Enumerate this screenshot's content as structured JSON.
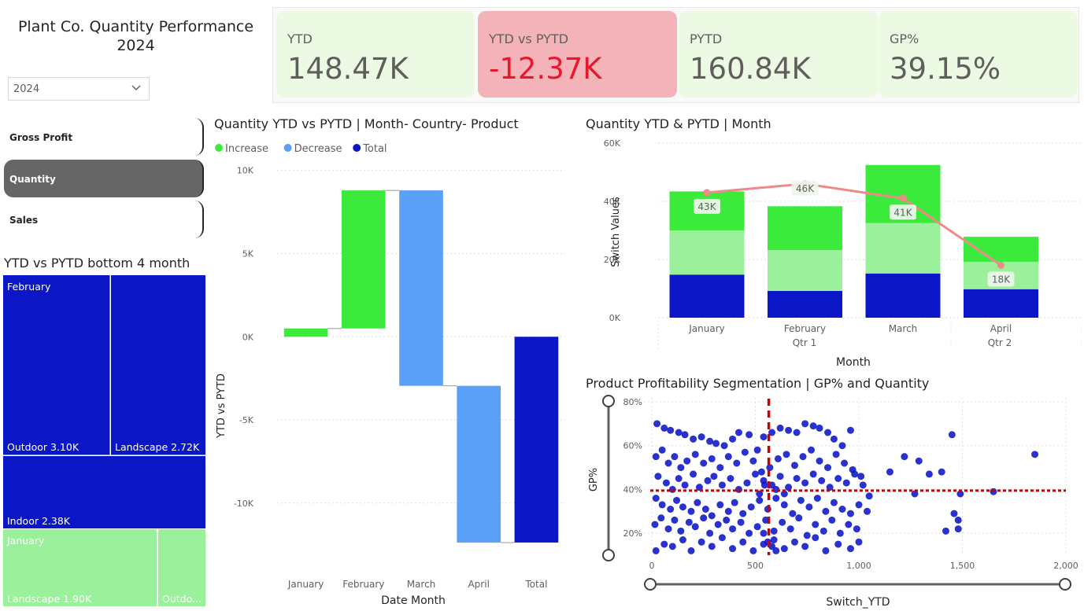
{
  "header": {
    "title": "Plant Co. Quantity Performance 2024",
    "year_value": "2024"
  },
  "kpis": [
    {
      "label": "YTD",
      "value": "148.47K"
    },
    {
      "label": "YTD vs PYTD",
      "value": "-12.37K"
    },
    {
      "label": "PYTD",
      "value": "160.84K"
    },
    {
      "label": "GP%",
      "value": "39.15%"
    }
  ],
  "nav": {
    "gross_profit": "Gross Profit",
    "quantity": "Quantity",
    "sales": "Sales"
  },
  "treemap": {
    "title": "YTD vs PYTD bottom 4 month",
    "february": "February",
    "january": "January",
    "cells": [
      "Outdoor 3.10K",
      "Landscape 2.72K",
      "Indoor 2.38K",
      "Landscape 1.90K",
      "Outdo..."
    ],
    "colors": {
      "feb": "#0b16c7",
      "jan": "#9bf09b"
    }
  },
  "chart_data": [
    {
      "type": "bar",
      "title": "Quantity YTD vs PYTD | Month- Country- Product",
      "xlabel": "Date Month",
      "ylabel": "YTD vs PYTD",
      "legend": [
        "Increase",
        "Decrease",
        "Total"
      ],
      "legend_colors": [
        "#3cea3c",
        "#5aa0f8",
        "#0b16c7"
      ],
      "categories": [
        "January",
        "February",
        "March",
        "April",
        "Total"
      ],
      "waterfall": [
        {
          "start": 0,
          "end": 500,
          "kind": "Increase"
        },
        {
          "start": 500,
          "end": 8800,
          "kind": "Increase"
        },
        {
          "start": 8800,
          "end": -2950,
          "kind": "Decrease"
        },
        {
          "start": -2950,
          "end": -12370,
          "kind": "Decrease"
        },
        {
          "start": 0,
          "end": -12370,
          "kind": "Total"
        }
      ],
      "yticks": [
        10000,
        5000,
        0,
        -5000,
        -10000
      ],
      "ytick_labels": [
        "10K",
        "5K",
        "0K",
        "-5K",
        "-10K"
      ],
      "ylim": [
        -14500,
        11500
      ]
    },
    {
      "type": "bar",
      "title": "Quantity YTD & PYTD | Month",
      "xlabel": "Month",
      "ylabel": "Switch Values",
      "categories": [
        "January",
        "February",
        "March",
        "April"
      ],
      "quarter_labels": [
        "Qtr 1",
        "Qtr 2"
      ],
      "series": [
        {
          "values": [
            14800,
            9200,
            15200,
            9800
          ],
          "color": "#0b16c7"
        },
        {
          "values": [
            15200,
            14000,
            17300,
            9400
          ],
          "color": "#9bf09b"
        },
        {
          "values": [
            13400,
            15100,
            20000,
            8600
          ],
          "color": "#3cea3c"
        }
      ],
      "line": {
        "values": [
          43000,
          46000,
          41000,
          18000
        ],
        "labels": [
          "43K",
          "46K",
          "41K",
          "18K"
        ],
        "color": "#f08a8a"
      },
      "yticks": [
        0,
        20000,
        40000,
        60000
      ],
      "ytick_labels": [
        "0K",
        "20K",
        "40K",
        "60K"
      ],
      "ylim": [
        0,
        60000
      ]
    },
    {
      "type": "scatter",
      "title": "Product Profitability Segmentation | GP% and Quantity",
      "xlabel": "Switch_YTD",
      "ylabel": "GP%",
      "xticks": [
        0,
        500,
        1000,
        1500,
        2000
      ],
      "xtick_labels": [
        "0",
        "500",
        "1,000",
        "1,500",
        "2,000"
      ],
      "yticks": [
        20,
        40,
        60,
        80
      ],
      "ytick_labels": [
        "20%",
        "40%",
        "60%",
        "80%"
      ],
      "xlim": [
        0,
        2000
      ],
      "ylim": [
        10,
        80
      ],
      "ref_x": 565,
      "ref_y": 39.5,
      "point_color": "#0b16c7",
      "points": [
        [
          25,
          70
        ],
        [
          60,
          68
        ],
        [
          90,
          67
        ],
        [
          130,
          66
        ],
        [
          160,
          65
        ],
        [
          200,
          63
        ],
        [
          240,
          64
        ],
        [
          280,
          62
        ],
        [
          310,
          61
        ],
        [
          350,
          60
        ],
        [
          390,
          63
        ],
        [
          420,
          66
        ],
        [
          470,
          65
        ],
        [
          510,
          58
        ],
        [
          540,
          64
        ],
        [
          580,
          66
        ],
        [
          620,
          68
        ],
        [
          660,
          67
        ],
        [
          700,
          66
        ],
        [
          740,
          70
        ],
        [
          780,
          69
        ],
        [
          810,
          68
        ],
        [
          850,
          66
        ],
        [
          880,
          63
        ],
        [
          920,
          60
        ],
        [
          960,
          67
        ],
        [
          20,
          55
        ],
        [
          50,
          58
        ],
        [
          80,
          52
        ],
        [
          110,
          55
        ],
        [
          140,
          50
        ],
        [
          170,
          53
        ],
        [
          210,
          56
        ],
        [
          250,
          52
        ],
        [
          290,
          54
        ],
        [
          330,
          50
        ],
        [
          370,
          55
        ],
        [
          410,
          52
        ],
        [
          450,
          57
        ],
        [
          490,
          53
        ],
        [
          530,
          48
        ],
        [
          570,
          50
        ],
        [
          610,
          54
        ],
        [
          650,
          56
        ],
        [
          690,
          51
        ],
        [
          730,
          55
        ],
        [
          770,
          58
        ],
        [
          810,
          53
        ],
        [
          850,
          50
        ],
        [
          890,
          56
        ],
        [
          930,
          52
        ],
        [
          970,
          49
        ],
        [
          1010,
          46
        ],
        [
          30,
          46
        ],
        [
          70,
          43
        ],
        [
          100,
          40
        ],
        [
          130,
          45
        ],
        [
          160,
          42
        ],
        [
          200,
          47
        ],
        [
          230,
          41
        ],
        [
          270,
          44
        ],
        [
          300,
          46
        ],
        [
          340,
          42
        ],
        [
          380,
          45
        ],
        [
          420,
          40
        ],
        [
          460,
          43
        ],
        [
          500,
          47
        ],
        [
          540,
          44
        ],
        [
          580,
          42
        ],
        [
          620,
          46
        ],
        [
          660,
          41
        ],
        [
          700,
          45
        ],
        [
          740,
          43
        ],
        [
          780,
          47
        ],
        [
          820,
          44
        ],
        [
          860,
          41
        ],
        [
          900,
          45
        ],
        [
          940,
          43
        ],
        [
          980,
          47
        ],
        [
          1020,
          42
        ],
        [
          1050,
          37
        ],
        [
          20,
          36
        ],
        [
          50,
          33
        ],
        [
          90,
          31
        ],
        [
          120,
          35
        ],
        [
          150,
          32
        ],
        [
          190,
          30
        ],
        [
          220,
          34
        ],
        [
          260,
          31
        ],
        [
          290,
          28
        ],
        [
          330,
          33
        ],
        [
          370,
          30
        ],
        [
          400,
          34
        ],
        [
          440,
          29
        ],
        [
          480,
          32
        ],
        [
          520,
          35
        ],
        [
          560,
          31
        ],
        [
          600,
          36
        ],
        [
          640,
          33
        ],
        [
          680,
          29
        ],
        [
          720,
          35
        ],
        [
          760,
          32
        ],
        [
          800,
          36
        ],
        [
          840,
          30
        ],
        [
          880,
          34
        ],
        [
          920,
          31
        ],
        [
          960,
          29
        ],
        [
          1000,
          33
        ],
        [
          1040,
          30
        ],
        [
          15,
          24
        ],
        [
          45,
          27
        ],
        [
          80,
          22
        ],
        [
          110,
          26
        ],
        [
          140,
          21
        ],
        [
          180,
          25
        ],
        [
          210,
          23
        ],
        [
          250,
          27
        ],
        [
          280,
          20
        ],
        [
          320,
          24
        ],
        [
          360,
          26
        ],
        [
          390,
          22
        ],
        [
          430,
          25
        ],
        [
          470,
          20
        ],
        [
          510,
          23
        ],
        [
          550,
          26
        ],
        [
          590,
          21
        ],
        [
          630,
          25
        ],
        [
          670,
          22
        ],
        [
          710,
          27
        ],
        [
          750,
          19
        ],
        [
          790,
          24
        ],
        [
          830,
          21
        ],
        [
          870,
          26
        ],
        [
          910,
          20
        ],
        [
          950,
          24
        ],
        [
          990,
          22
        ],
        [
          20,
          12
        ],
        [
          60,
          15
        ],
        [
          100,
          14
        ],
        [
          150,
          17
        ],
        [
          190,
          12
        ],
        [
          240,
          16
        ],
        [
          290,
          14
        ],
        [
          340,
          18
        ],
        [
          390,
          13
        ],
        [
          440,
          16
        ],
        [
          490,
          12
        ],
        [
          540,
          15
        ],
        [
          590,
          17
        ],
        [
          640,
          13
        ],
        [
          690,
          16
        ],
        [
          740,
          14
        ],
        [
          790,
          18
        ],
        [
          840,
          12
        ],
        [
          900,
          15
        ],
        [
          960,
          13
        ],
        [
          1000,
          16
        ],
        [
          560,
          16
        ],
        [
          580,
          14
        ],
        [
          600,
          12
        ],
        [
          540,
          20
        ],
        [
          520,
          38
        ],
        [
          545,
          42
        ],
        [
          600,
          40
        ],
        [
          640,
          38
        ],
        [
          1150,
          48
        ],
        [
          1220,
          55
        ],
        [
          1290,
          53
        ],
        [
          1340,
          47
        ],
        [
          1400,
          48
        ],
        [
          1450,
          65
        ],
        [
          1480,
          22
        ],
        [
          1490,
          38
        ],
        [
          1650,
          39
        ],
        [
          1850,
          56
        ],
        [
          1270,
          38
        ],
        [
          1460,
          29
        ],
        [
          1480,
          26
        ],
        [
          1420,
          21
        ]
      ]
    }
  ]
}
